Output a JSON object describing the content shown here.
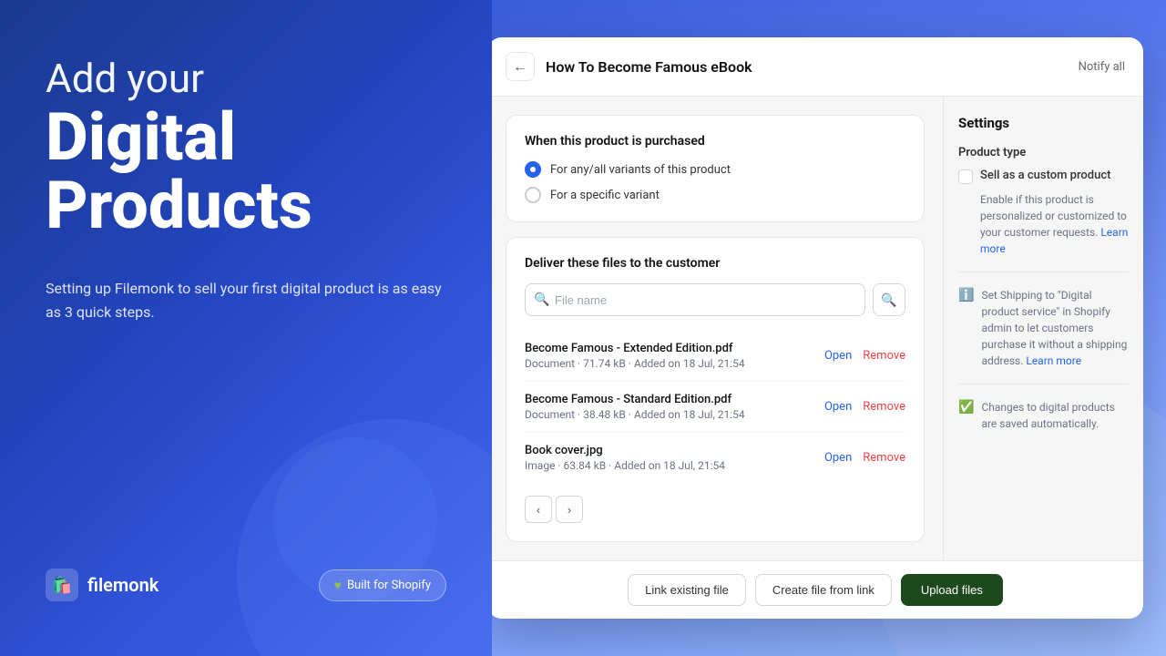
{
  "left": {
    "hero": {
      "line1": "Add your",
      "line2": "Digital",
      "line3": "Products"
    },
    "subtitle": "Setting up Filemonk to sell your first digital product is as easy as 3 quick steps.",
    "logo": {
      "name": "filemonk",
      "icon": "🛍️"
    },
    "built_for_shopify": "Built for Shopify"
  },
  "modal": {
    "header": {
      "back_label": "←",
      "title": "How To Become Famous eBook",
      "notify_label": "Notify all"
    },
    "purchase_section": {
      "title": "When this product is purchased",
      "options": [
        {
          "label": "For any/all variants of this product",
          "selected": true
        },
        {
          "label": "For a specific variant",
          "selected": false
        }
      ]
    },
    "files_section": {
      "title": "Deliver these files to the customer",
      "search_placeholder": "File name",
      "files": [
        {
          "name": "Become Famous - Extended Edition.pdf",
          "meta": "Document · 71.74 kB · Added on 18 Jul, 21:54"
        },
        {
          "name": "Become Famous - Standard Edition.pdf",
          "meta": "Document · 38.48 kB · Added on 18 Jul, 21:54"
        },
        {
          "name": "Book cover.jpg",
          "meta": "Image · 63.84 kB · Added on 18 Jul, 21:54"
        }
      ],
      "action_open": "Open",
      "action_remove": "Remove"
    },
    "footer": {
      "link_existing": "Link existing file",
      "create_from_link": "Create file from link",
      "upload": "Upload files"
    }
  },
  "settings": {
    "title": "Settings",
    "product_type": {
      "label": "Product type",
      "checkbox_label": "Sell as a custom product",
      "description": "Enable if this product is personalized or customized to your customer requests.",
      "learn_more": "Learn more"
    },
    "shipping_info": "Set Shipping to \"Digital product service\" in Shopify admin to let customers purchase it without a shipping address.",
    "shipping_learn_more": "Learn more",
    "auto_save": "Changes to digital products are saved automatically."
  }
}
